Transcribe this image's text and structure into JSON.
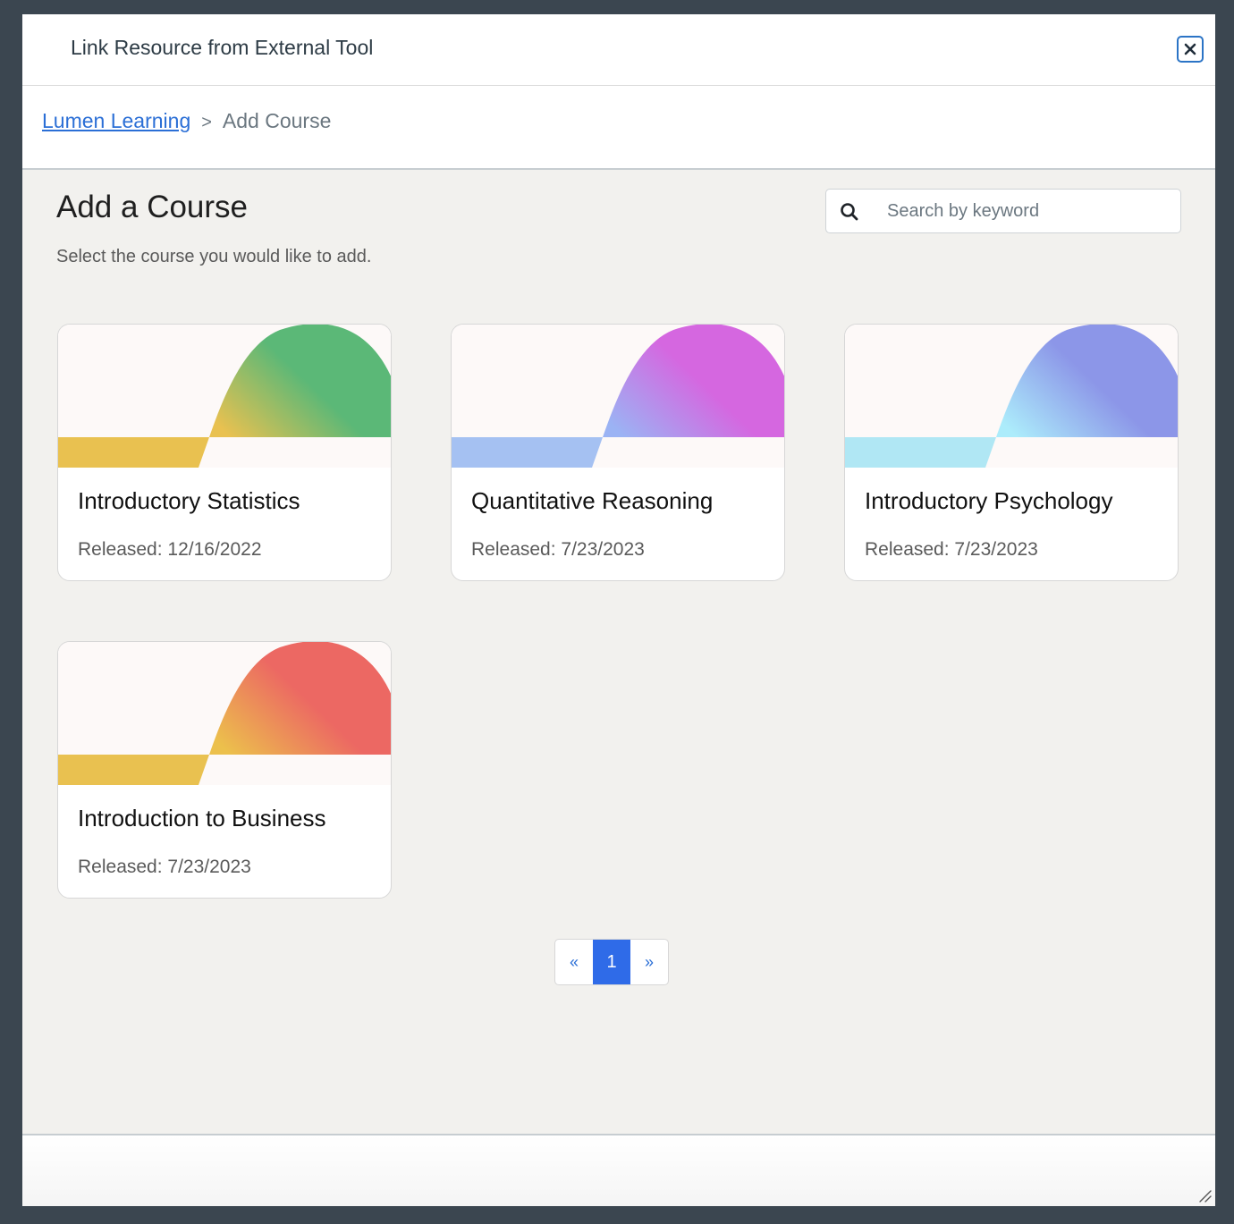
{
  "dialog": {
    "title": "Link Resource from External Tool",
    "close_icon": "close-icon"
  },
  "breadcrumb": {
    "link": "Lumen Learning",
    "separator": ">",
    "current": "Add Course"
  },
  "page": {
    "heading": "Add a Course",
    "subheading": "Select the course you would like to add."
  },
  "search": {
    "placeholder": "Search by keyword",
    "value": "",
    "icon": "search-icon"
  },
  "courses": [
    {
      "title": "Introductory Statistics",
      "released": "Released: 12/16/2022",
      "colors": {
        "band": "#e9c150",
        "arc_start": "#e9c150",
        "arc_end": "#5bb877"
      }
    },
    {
      "title": "Quantitative Reasoning",
      "released": "Released: 7/23/2023",
      "colors": {
        "band": "#a5c1f2",
        "arc_start": "#9bb3f4",
        "arc_end": "#d567e0"
      }
    },
    {
      "title": "Introductory Psychology",
      "released": "Released: 7/23/2023",
      "colors": {
        "band": "#b0e7f4",
        "arc_start": "#acecfb",
        "arc_end": "#8c96e8"
      }
    },
    {
      "title": "Introduction to Business",
      "released": "Released: 7/23/2023",
      "colors": {
        "band": "#e9c150",
        "arc_start": "#ecc04c",
        "arc_end": "#ec6863"
      }
    }
  ],
  "pagination": {
    "prev": "«",
    "current": "1",
    "next": "»",
    "active_color": "#2f6be8"
  },
  "colors": {
    "link": "#2b6fd6",
    "content_bg": "#f2f1ee",
    "backdrop": "#3b4650"
  }
}
